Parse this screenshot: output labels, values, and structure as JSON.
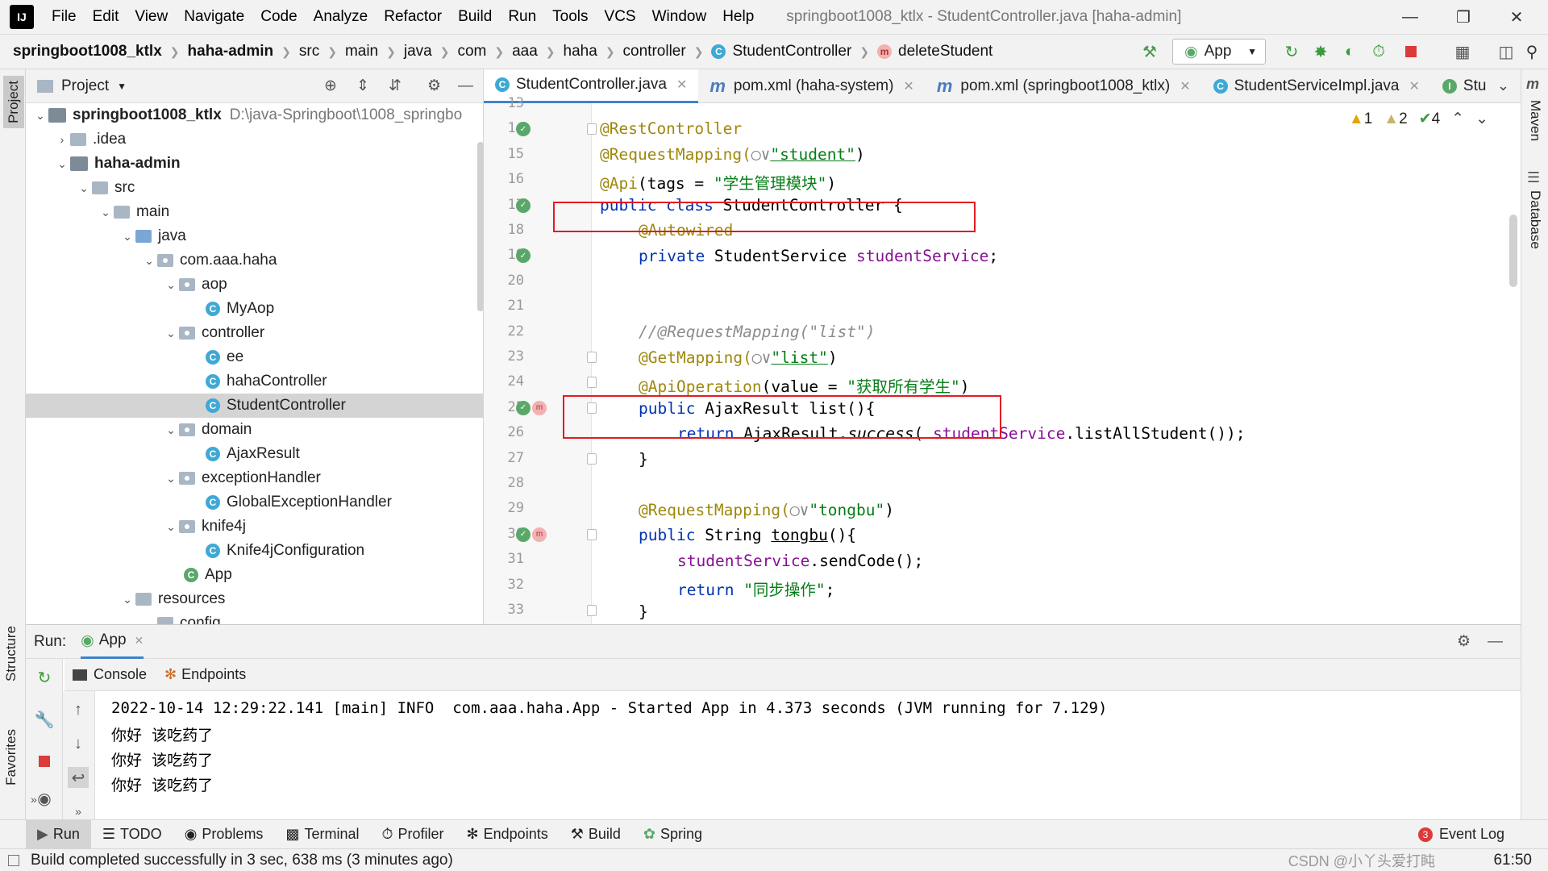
{
  "menubar": {
    "items": [
      "File",
      "Edit",
      "View",
      "Navigate",
      "Code",
      "Analyze",
      "Refactor",
      "Build",
      "Run",
      "Tools",
      "VCS",
      "Window",
      "Help"
    ],
    "title": "springboot1008_ktlx - StudentController.java [haha-admin]"
  },
  "breadcrumb": [
    "springboot1008_ktlx",
    "haha-admin",
    "src",
    "main",
    "java",
    "com",
    "aaa",
    "haha",
    "controller",
    "StudentController",
    "deleteStudent"
  ],
  "toolbar": {
    "run_config": "App"
  },
  "project_panel": {
    "title": "Project",
    "tree": [
      {
        "label": "springboot1008_ktlx",
        "path": "D:\\java-Springboot\\1008_springbo",
        "indent": 0,
        "type": "module",
        "open": true
      },
      {
        "label": ".idea",
        "indent": 1,
        "type": "folder",
        "open": false
      },
      {
        "label": "haha-admin",
        "indent": 1,
        "type": "module",
        "open": true
      },
      {
        "label": "src",
        "indent": 2,
        "type": "folder",
        "open": true
      },
      {
        "label": "main",
        "indent": 3,
        "type": "folder",
        "open": true
      },
      {
        "label": "java",
        "indent": 4,
        "type": "src",
        "open": true
      },
      {
        "label": "com.aaa.haha",
        "indent": 5,
        "type": "pkg",
        "open": true
      },
      {
        "label": "aop",
        "indent": 6,
        "type": "pkg",
        "open": true
      },
      {
        "label": "MyAop",
        "indent": 7,
        "type": "class"
      },
      {
        "label": "controller",
        "indent": 6,
        "type": "pkg",
        "open": true
      },
      {
        "label": "ee",
        "indent": 7,
        "type": "class"
      },
      {
        "label": "hahaController",
        "indent": 7,
        "type": "class"
      },
      {
        "label": "StudentController",
        "indent": 7,
        "type": "class",
        "selected": true
      },
      {
        "label": "domain",
        "indent": 6,
        "type": "pkg",
        "open": true
      },
      {
        "label": "AjaxResult",
        "indent": 7,
        "type": "class"
      },
      {
        "label": "exceptionHandler",
        "indent": 6,
        "type": "pkg",
        "open": true
      },
      {
        "label": "GlobalExceptionHandler",
        "indent": 7,
        "type": "class"
      },
      {
        "label": "knife4j",
        "indent": 6,
        "type": "pkg",
        "open": true
      },
      {
        "label": "Knife4jConfiguration",
        "indent": 7,
        "type": "class"
      },
      {
        "label": "App",
        "indent": 6,
        "type": "app"
      },
      {
        "label": "resources",
        "indent": 4,
        "type": "res",
        "open": true
      },
      {
        "label": "config",
        "indent": 5,
        "type": "folder",
        "open": true
      }
    ]
  },
  "editor": {
    "tabs": [
      {
        "label": "StudentController.java",
        "icon": "C",
        "active": true
      },
      {
        "label": "pom.xml (haha-system)",
        "icon": "m"
      },
      {
        "label": "pom.xml (springboot1008_ktlx)",
        "icon": "m"
      },
      {
        "label": "StudentServiceImpl.java",
        "icon": "C"
      },
      {
        "label": "Stu",
        "icon": "I"
      }
    ],
    "inspections": {
      "warnings": "1",
      "weak": "2",
      "ok": "4"
    },
    "line_numbers": [
      "13",
      "14",
      "15",
      "16",
      "17",
      "18",
      "19",
      "20",
      "21",
      "22",
      "23",
      "24",
      "25",
      "26",
      "27",
      "28",
      "29",
      "30",
      "31",
      "32",
      "33"
    ]
  },
  "code": {
    "l14": "@RestController",
    "l15a": "@RequestMapping(",
    "l15b": "\"student\"",
    "l15c": ")",
    "l16a": "@Api",
    "l16b": "(tags = ",
    "l16c": "\"学生管理模块\"",
    "l16d": ")",
    "l17a": "public class ",
    "l17b": "StudentController {",
    "l18": "@Autowired",
    "l19a": "private ",
    "l19b": "StudentService ",
    "l19c": "studentService",
    "l19d": ";",
    "l22": "//@RequestMapping(\"list\")",
    "l23a": "@GetMapping(",
    "l23b": "\"list\"",
    "l23c": ")",
    "l24a": "@ApiOperation",
    "l24b": "(value = ",
    "l24c": "\"获取所有学生\"",
    "l24d": ")",
    "l25a": "public ",
    "l25b": "AjaxResult ",
    "l25c": "list",
    "l25d": "(){",
    "l26a": "return ",
    "l26b": "AjaxResult.",
    "l26c": "success",
    "l26d": "( ",
    "l26e": "studentService",
    "l26f": ".listAllStudent());",
    "l27": "}",
    "l29a": "@RequestMapping(",
    "l29b": "\"tongbu\"",
    "l29c": ")",
    "l30a": "public ",
    "l30b": "String ",
    "l30c": "tongbu",
    "l30d": "(){",
    "l31a": "studentService",
    "l31b": ".sendCode();",
    "l32a": "return ",
    "l32b": "\"同步操作\"",
    "l32c": ";",
    "l33": "}"
  },
  "run_panel": {
    "label": "Run:",
    "tab": "App",
    "subtabs": [
      "Console",
      "Endpoints"
    ],
    "console": [
      "2022-10-14 12:29:22.141 [main] INFO  com.aaa.haha.App - Started App in 4.373 seconds (JVM running for 7.129)",
      "你好  该吃药了",
      "你好  该吃药了",
      "你好  该吃药了"
    ]
  },
  "bottom_tabs": [
    "Run",
    "TODO",
    "Problems",
    "Terminal",
    "Profiler",
    "Endpoints",
    "Build",
    "Spring"
  ],
  "event_log": {
    "label": "Event Log",
    "count": "3"
  },
  "side_tabs": {
    "left": [
      "Project",
      "Structure",
      "Favorites"
    ],
    "right": [
      "Maven",
      "Database"
    ]
  },
  "status": {
    "message": "Build completed successfully in 3 sec, 638 ms (3 minutes ago)",
    "position": "61:50",
    "watermark": "CSDN @小丫头爱打盹"
  }
}
